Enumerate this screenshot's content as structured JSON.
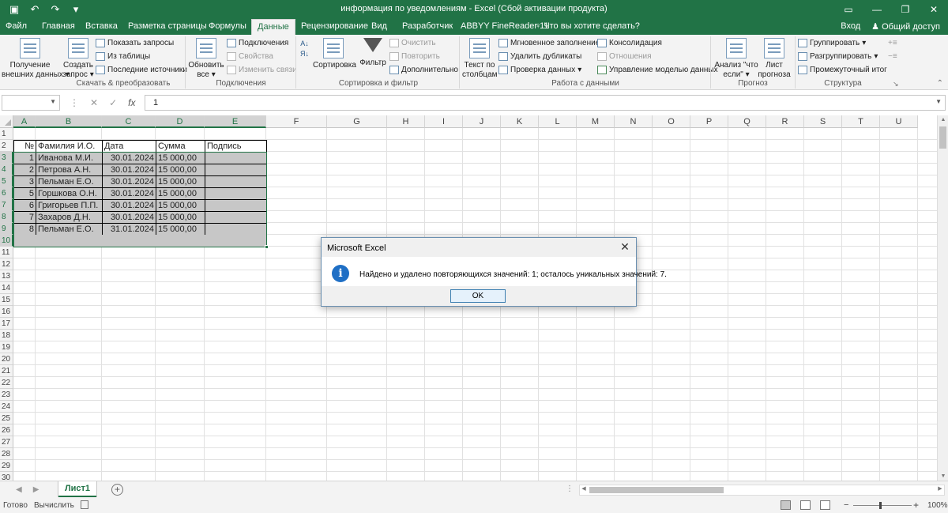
{
  "app": {
    "title": "информация по уведомлениям - Excel (Сбой активации продукта)",
    "qat_icons": [
      "save-icon",
      "undo-icon",
      "redo-icon",
      "customize-icon"
    ]
  },
  "tabs": [
    "Файл",
    "Главная",
    "Вставка",
    "Разметка страницы",
    "Формулы",
    "Данные",
    "Рецензирование",
    "Вид",
    "Разработчик",
    "ABBYY FineReader 11"
  ],
  "active_tab": "Данные",
  "tell_me": "Что вы хотите сделать?",
  "signin": "Вход",
  "share": "Общий доступ",
  "ribbon": {
    "get_external": [
      "Получение",
      "внешних данных"
    ],
    "create_query": [
      "Создать",
      "запрос"
    ],
    "show_queries": "Показать запросы",
    "from_table": "Из таблицы",
    "recent_sources": "Последние источники",
    "group_transform": "Скачать & преобразовать",
    "refresh_all": [
      "Обновить",
      "все"
    ],
    "connections": "Подключения",
    "properties": "Свойства",
    "edit_links": "Изменить связи",
    "group_connections": "Подключения",
    "sort_az": "А↓Я",
    "sort": "Сортировка",
    "filter": "Фильтр",
    "clear": "Очистить",
    "reapply": "Повторить",
    "advanced": "Дополнительно",
    "group_sort": "Сортировка и фильтр",
    "text_to_cols": [
      "Текст по",
      "столбцам"
    ],
    "flash_fill": "Мгновенное заполнение",
    "remove_dupes": "Удалить дубликаты",
    "validation": "Проверка данных",
    "consolidate": "Консолидация",
    "relationships": "Отношения",
    "data_model": "Управление моделью данных",
    "group_tools": "Работа с данными",
    "whatif": [
      "Анализ \"что",
      "если\""
    ],
    "forecast_sheet": [
      "Лист",
      "прогноза"
    ],
    "group_forecast": "Прогноз",
    "group_btn": "Группировать",
    "ungroup": "Разгруппировать",
    "subtotal": "Промежуточный итог",
    "group_outline": "Структура"
  },
  "formula_bar": {
    "name_box": "",
    "value": "1"
  },
  "columns": [
    "A",
    "B",
    "C",
    "D",
    "E",
    "F",
    "G",
    "H",
    "I",
    "J",
    "K",
    "L",
    "M",
    "N",
    "O",
    "P",
    "Q",
    "R",
    "S",
    "T",
    "U"
  ],
  "rows": [
    "1",
    "2",
    "3",
    "4",
    "5",
    "6",
    "7",
    "8",
    "9",
    "10",
    "11",
    "12",
    "13",
    "14",
    "15",
    "16",
    "17",
    "18",
    "19",
    "20",
    "21",
    "22",
    "23",
    "24",
    "25",
    "26",
    "27",
    "28",
    "29",
    "30"
  ],
  "table": {
    "headers": [
      "№",
      "Фамилия И.О.",
      "Дата",
      "Сумма",
      "Подпись"
    ],
    "rows": [
      [
        "1",
        "Иванова М.И.",
        "30.01.2024",
        "15 000,00",
        ""
      ],
      [
        "2",
        "Петрова А.Н.",
        "30.01.2024",
        "15 000,00",
        ""
      ],
      [
        "3",
        "Пельман Е.О.",
        "30.01.2024",
        "15 000,00",
        ""
      ],
      [
        "5",
        "Горшкова О.Н.",
        "30.01.2024",
        "15 000,00",
        ""
      ],
      [
        "6",
        "Григорьев П.П.",
        "30.01.2024",
        "15 000,00",
        ""
      ],
      [
        "7",
        "Захаров Д.Н.",
        "30.01.2024",
        "15 000,00",
        ""
      ],
      [
        "8",
        "Пельман Е.О.",
        "31.01.2024",
        "15 000,00",
        ""
      ]
    ]
  },
  "sheet_tab": "Лист1",
  "status": {
    "ready": "Готово",
    "calculate": "Вычислить",
    "zoom": "100%"
  },
  "dialog": {
    "title": "Microsoft Excel",
    "message": "Найдено и удалено повторяющихся значений: 1; осталось уникальных значений: 7.",
    "ok": "OK"
  },
  "colors": {
    "accent": "#217346",
    "selection_fill": "#c7c7c7",
    "info_blue": "#1f6fc5"
  }
}
